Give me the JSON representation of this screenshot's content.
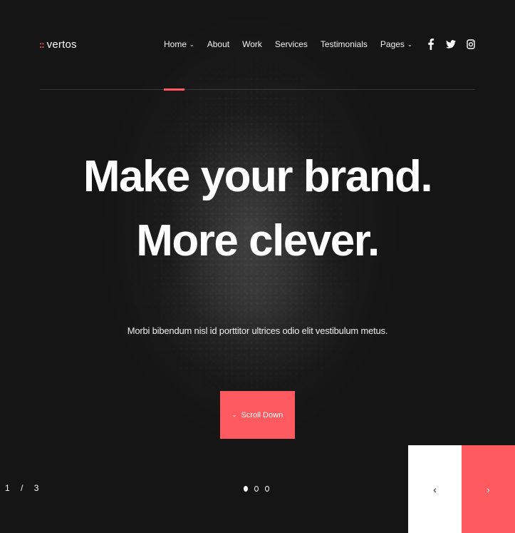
{
  "brand": {
    "logo_mark": "::",
    "name": "vertos",
    "accent_color": "#ff5a5f"
  },
  "nav": {
    "items": [
      {
        "label": "Home",
        "has_dropdown": true,
        "active": true
      },
      {
        "label": "About",
        "has_dropdown": false
      },
      {
        "label": "Work",
        "has_dropdown": false
      },
      {
        "label": "Services",
        "has_dropdown": false
      },
      {
        "label": "Testimonials",
        "has_dropdown": false
      },
      {
        "label": "Pages",
        "has_dropdown": true
      }
    ],
    "dropdown_icon": "chevron-down-icon"
  },
  "social": {
    "icons": [
      "facebook-icon",
      "twitter-icon",
      "instagram-icon"
    ]
  },
  "hero": {
    "headline_line1": "Make your brand.",
    "headline_line2": "More clever.",
    "subtext": "Morbi bibendum nisl id porttitor ultrices odio elit vestibulum metus.",
    "cta_label": "Scroll Down",
    "cta_icon": "chevron-down-icon"
  },
  "slider": {
    "current": "1",
    "separator": "/",
    "total": "3",
    "dots": 3,
    "active_dot": 1,
    "prev_icon": "chevron-left-icon",
    "next_icon": "chevron-right-icon",
    "prev_glyph": "‹",
    "next_glyph": "›"
  }
}
